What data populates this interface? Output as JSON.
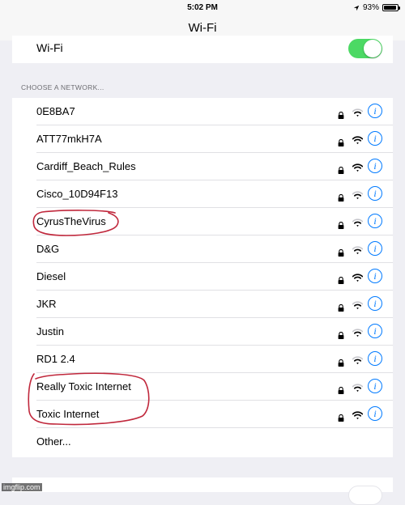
{
  "status_bar": {
    "time": "5:02 PM",
    "battery": "93%",
    "battery_level": 0.93
  },
  "nav": {
    "title": "Wi-Fi"
  },
  "wifi_toggle": {
    "label": "Wi-Fi",
    "on": true,
    "on_color": "#4cd964"
  },
  "section": {
    "header": "CHOOSE A NETWORK..."
  },
  "networks": [
    {
      "name": "0E8BA7",
      "locked": true,
      "signal": 2,
      "circled": false
    },
    {
      "name": "ATT77mkH7A",
      "locked": true,
      "signal": 3,
      "circled": false
    },
    {
      "name": "Cardiff_Beach_Rules",
      "locked": true,
      "signal": 3,
      "circled": false
    },
    {
      "name": "Cisco_10D94F13",
      "locked": true,
      "signal": 2,
      "circled": false
    },
    {
      "name": "CyrusTheVirus",
      "locked": true,
      "signal": 2,
      "circled": true
    },
    {
      "name": "D&G",
      "locked": true,
      "signal": 2,
      "circled": false
    },
    {
      "name": "Diesel",
      "locked": true,
      "signal": 3,
      "circled": false
    },
    {
      "name": "JKR",
      "locked": true,
      "signal": 2,
      "circled": false
    },
    {
      "name": "Justin",
      "locked": true,
      "signal": 2,
      "circled": false
    },
    {
      "name": "RD1 2.4",
      "locked": true,
      "signal": 2,
      "circled": false
    },
    {
      "name": "Really Toxic Internet",
      "locked": true,
      "signal": 2,
      "circled": true
    },
    {
      "name": "Toxic Internet",
      "locked": true,
      "signal": 3,
      "circled": true
    }
  ],
  "other_label": "Other...",
  "accent_color": "#007aff",
  "annotation_color": "#c0283c",
  "watermark": "imgflip.com",
  "icons": {
    "lock": "lock-icon",
    "wifi": "wifi-signal-icon",
    "info": "info-icon",
    "location": "location-arrow-icon",
    "battery": "battery-icon"
  }
}
